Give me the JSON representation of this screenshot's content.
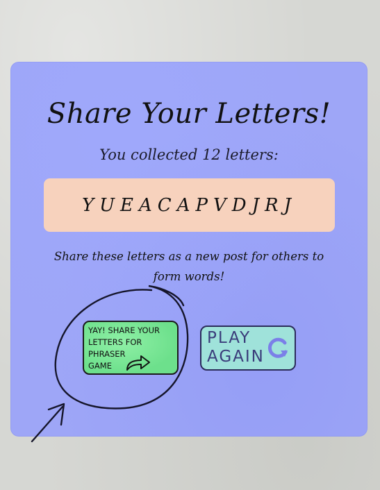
{
  "title": "Share Your Letters!",
  "subtitle": "You collected 12 letters:",
  "letters": "YUEACAPVDJRJ",
  "hint": "Share these letters as a new post for others to form words!",
  "share_button": {
    "label": "YAY! SHARE YOUR\nLETTERS FOR PHRASER\nGAME"
  },
  "play_button": {
    "label": "PLAY\nAGAIN"
  },
  "icons": {
    "share": "share-arrow-icon",
    "replay": "replay-icon"
  },
  "colors": {
    "card": "#9ea6f7",
    "letters_box": "#f7d2bd",
    "share": "#7be79a",
    "play": "#9fe2da"
  }
}
